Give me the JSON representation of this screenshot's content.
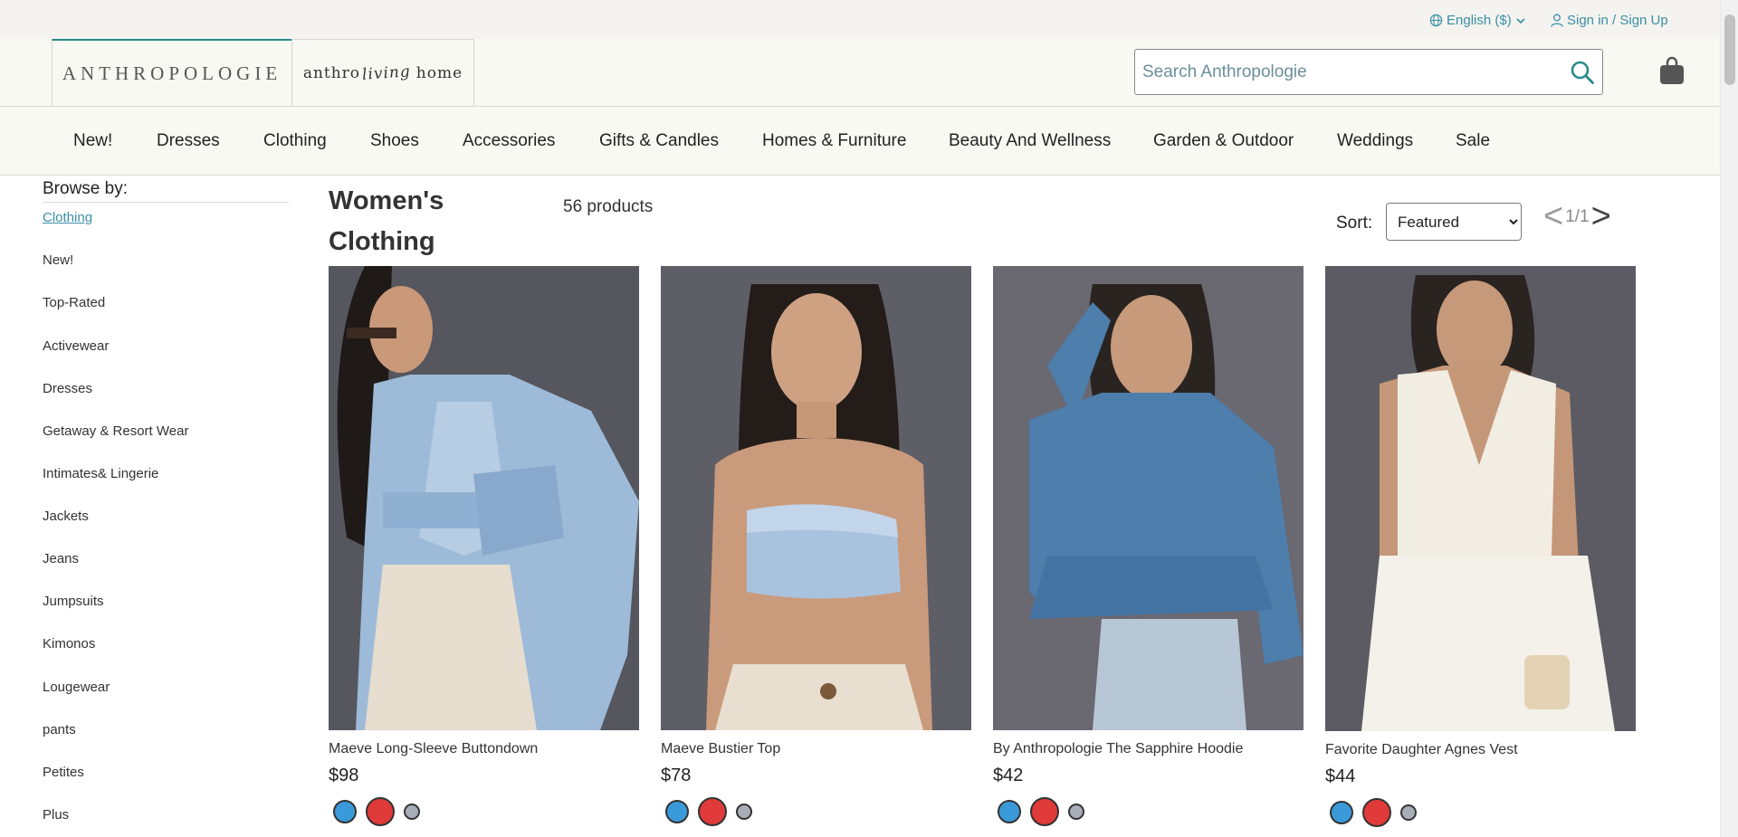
{
  "utility": {
    "language": "English ($)",
    "sign_in": "Sign in / Sign Up"
  },
  "header": {
    "logo": "ANTHROPOLOGIE",
    "logo_home_prefix": "anthro",
    "logo_home_script": "living",
    "logo_home_suffix": "home",
    "search_placeholder": "Search Anthropologie"
  },
  "nav": {
    "items": [
      {
        "label": "New!"
      },
      {
        "label": "Dresses"
      },
      {
        "label": "Clothing"
      },
      {
        "label": "Shoes"
      },
      {
        "label": "Accessories"
      },
      {
        "label": "Gifts & Candles"
      },
      {
        "label": "Homes & Furniture"
      },
      {
        "label": "Beauty And Wellness"
      },
      {
        "label": "Garden & Outdoor"
      },
      {
        "label": "Weddings"
      },
      {
        "label": "Sale"
      }
    ]
  },
  "sidebar": {
    "title": "Browse by:",
    "items": [
      {
        "label": "Clothing",
        "active": true
      },
      {
        "label": "New!"
      },
      {
        "label": "Top-Rated"
      },
      {
        "label": "Activewear"
      },
      {
        "label": "Dresses"
      },
      {
        "label": "Getaway & Resort Wear"
      },
      {
        "label": "Intimates& Lingerie"
      },
      {
        "label": "Jackets"
      },
      {
        "label": "Jeans"
      },
      {
        "label": "Jumpsuits"
      },
      {
        "label": "Kimonos"
      },
      {
        "label": "Lougewear"
      },
      {
        "label": "pants"
      },
      {
        "label": "Petites"
      },
      {
        "label": "Plus"
      }
    ]
  },
  "main": {
    "title": "Women's Clothing",
    "product_count": "56 products",
    "sort_label": "Sort:",
    "sort_value": "Featured",
    "pager": "1/1",
    "pager_prev": "<",
    "pager_next": ">"
  },
  "products": [
    {
      "name": "Maeve Long-Sleeve Buttondown",
      "price": "$98",
      "swatches": [
        "#3a9ad9",
        "#e03a3a",
        "#a8adb8"
      ]
    },
    {
      "name": "Maeve Bustier Top",
      "price": "$78",
      "swatches": [
        "#3a9ad9",
        "#e03a3a",
        "#a8adb8"
      ]
    },
    {
      "name": "By Anthropologie The Sapphire Hoodie",
      "price": "$42",
      "swatches": [
        "#3a9ad9",
        "#e03a3a",
        "#a8adb8"
      ]
    },
    {
      "name": "Favorite Daughter Agnes Vest",
      "price": "$44",
      "swatches": [
        "#3a9ad9",
        "#e03a3a",
        "#a8adb8"
      ]
    }
  ],
  "colors": {
    "link_accent": "#3b8fa6",
    "logo_accent": "#2a8a8a"
  }
}
